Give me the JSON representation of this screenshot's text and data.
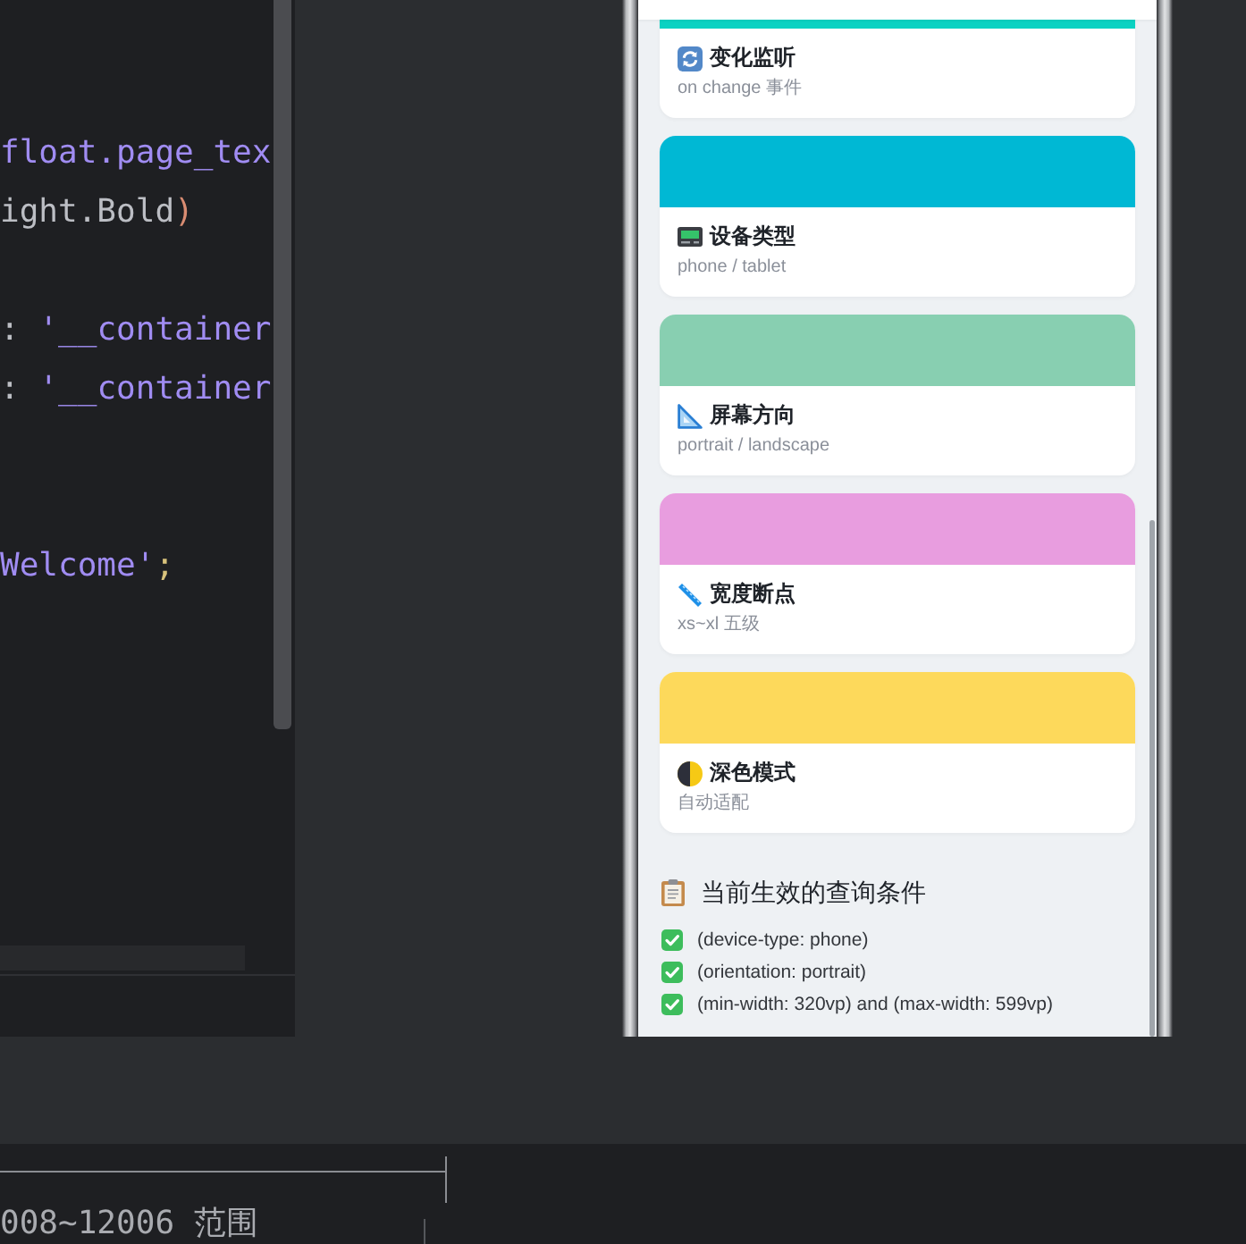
{
  "editor": {
    "lines": [
      {
        "kind": "blank"
      },
      {
        "kind": "blank"
      },
      {
        "kind": "code",
        "tokens": [
          {
            "text": "float.page_tex",
            "kind": "member"
          }
        ]
      },
      {
        "kind": "code",
        "tokens": [
          {
            "text": "ight.Bold",
            "kind": "plain"
          },
          {
            "text": ")",
            "kind": "bracket"
          }
        ]
      },
      {
        "kind": "blank"
      },
      {
        "kind": "code",
        "tokens": [
          {
            "text": ": ",
            "kind": "plain"
          },
          {
            "text": "'__container",
            "kind": "string"
          }
        ]
      },
      {
        "kind": "code",
        "tokens": [
          {
            "text": ": ",
            "kind": "plain"
          },
          {
            "text": "'__container",
            "kind": "string"
          }
        ]
      },
      {
        "kind": "blank"
      },
      {
        "kind": "blank"
      },
      {
        "kind": "code",
        "tokens": [
          {
            "text": "Welcome'",
            "kind": "string"
          },
          {
            "text": ";",
            "kind": "punctuation"
          }
        ]
      }
    ]
  },
  "preview": {
    "cards": [
      {
        "title": "变化监听",
        "subtitle": "on change 事件",
        "color": "#0ad2c2"
      },
      {
        "title": "设备类型",
        "subtitle": "phone / tablet",
        "color": "#00b8d4"
      },
      {
        "title": "屏幕方向",
        "subtitle": "portrait / landscape",
        "color": "#88cfb1"
      },
      {
        "title": "宽度断点",
        "subtitle": "xs~xl 五级",
        "color": "#e89ddf"
      },
      {
        "title": "深色模式",
        "subtitle": "自动适配",
        "color": "#fdd95b"
      }
    ],
    "conditions": {
      "title": "当前生效的查询条件",
      "items": [
        {
          "text": "(device-type: phone)",
          "checked": true
        },
        {
          "text": "(orientation: portrait)",
          "checked": true
        },
        {
          "text": "(min-width: 320vp) and (max-width: 599vp)",
          "checked": true
        }
      ]
    }
  },
  "terminal": {
    "lines": [
      "008~12006 范围"
    ]
  }
}
